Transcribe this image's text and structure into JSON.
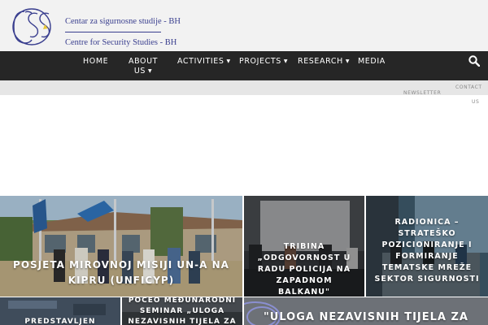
{
  "header": {
    "logo_line1": "Centar za sigurnosne studije - BH",
    "logo_line2": "Centre for Security Studies - BH",
    "brand_color": "#3a3f8f"
  },
  "nav": {
    "items": [
      {
        "label": "HOME"
      },
      {
        "label": "ABOUT",
        "label2": "US",
        "dropdown": true
      },
      {
        "label": "ACTIVITIES",
        "dropdown": true
      },
      {
        "label": "PROJECTS",
        "dropdown": true
      },
      {
        "label": "RESEARCH",
        "dropdown": true
      },
      {
        "label": "MEDIA"
      }
    ],
    "arrow_glyph": "▼",
    "search_icon": "search-icon"
  },
  "subbar": {
    "newsletter": "NEWSLETTER",
    "contact_line1": "CONTACT",
    "contact_line2": "US"
  },
  "tiles": [
    {
      "caption": "POSJETA MIROVNOJ MISIJI UN-A NA KIPRU (UNFICYP)"
    },
    {
      "caption": "TRIBINA „ODGOVORNOST U RADU POLICIJA NA ZAPADNOM BALKANU\""
    },
    {
      "caption": "RADIONICA – STRATEŠKO POZICIONIRANJE I FORMIRANJE TEMATSKE MREŽE SEKTOR SIGURNOSTI"
    },
    {
      "caption": "PREDSTAVLJEN"
    },
    {
      "caption": "POČEO MEĐUNARODNI SEMINAR „ULOGA NEZAVISNIH TIJELA ZA"
    },
    {
      "caption": "\"ULOGA NEZAVISNIH TIJELA ZA"
    }
  ]
}
